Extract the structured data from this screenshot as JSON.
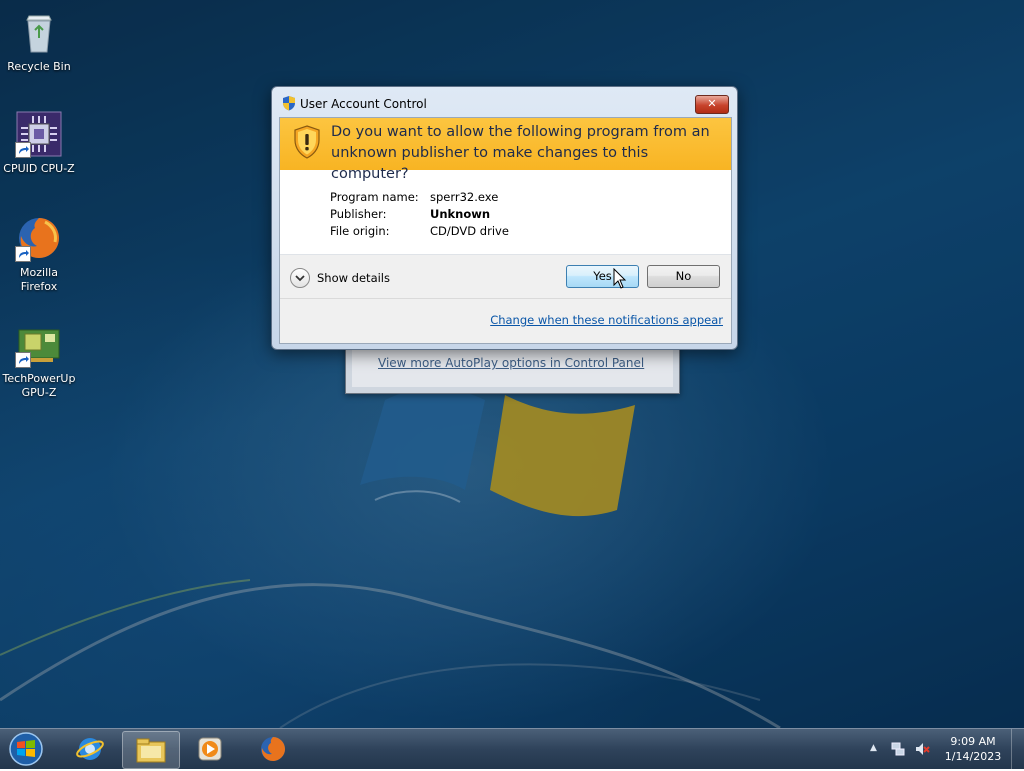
{
  "desktop": {
    "icons": [
      {
        "label": "Recycle Bin",
        "icon": "recycle-bin-icon"
      },
      {
        "label": "CPUID CPU-Z",
        "icon": "cpu-z-icon"
      },
      {
        "label_line1": "Mozilla",
        "label_line2": "Firefox",
        "icon": "firefox-icon"
      },
      {
        "label_line1": "TechPowerUp",
        "label_line2": "GPU-Z",
        "icon": "gpu-z-icon"
      }
    ]
  },
  "autoplay": {
    "link_text": "View more AutoPlay options in Control Panel"
  },
  "uac": {
    "title": "User Account Control",
    "close_label": "✕",
    "question": "Do you want to allow the following program from an unknown publisher to make changes to this computer?",
    "fields": [
      {
        "key": "Program name:",
        "value": "sperr32.exe"
      },
      {
        "key": "Publisher:",
        "value": "Unknown"
      },
      {
        "key": "File origin:",
        "value": "CD/DVD drive"
      }
    ],
    "show_details_label": "Show details",
    "yes_label": "Yes",
    "no_label": "No",
    "change_link": "Change when these notifications appear",
    "banner_color": "#F9BC2F"
  },
  "taskbar": {
    "items": [
      "internet-explorer-icon",
      "windows-explorer-icon",
      "media-player-icon",
      "firefox-icon"
    ],
    "clock_time": "9:09 AM",
    "clock_date": "1/14/2023"
  }
}
